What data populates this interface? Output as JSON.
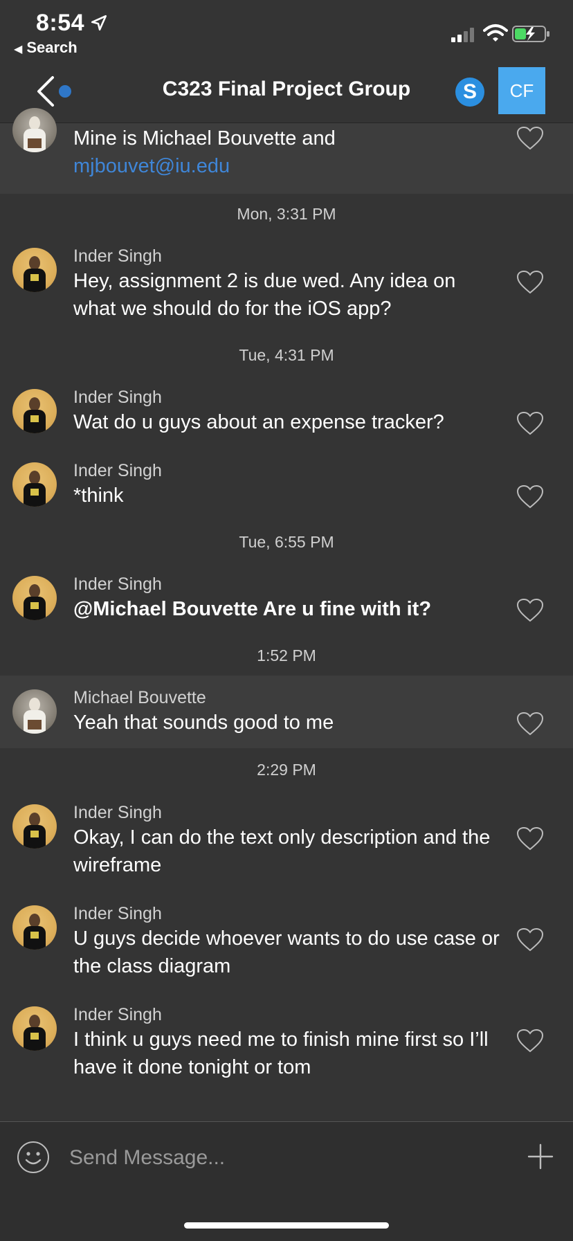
{
  "status_bar": {
    "time": "8:54",
    "back_app": "Search"
  },
  "header": {
    "title": "C323 Final Project Group",
    "skype_letter": "S",
    "user_initials": "CF"
  },
  "messages": [
    {
      "sender": "",
      "text": "Mine is Michael Bouvette and",
      "link": "mjbouvet@iu.edu"
    },
    {
      "timestamp": "Mon, 3:31 PM"
    },
    {
      "sender": "Inder Singh",
      "text": "Hey, assignment 2 is due wed. Any idea on what we should do for the iOS app?"
    },
    {
      "timestamp": "Tue, 4:31 PM"
    },
    {
      "sender": "Inder Singh",
      "text": "Wat do u guys about an expense tracker?"
    },
    {
      "sender": "Inder Singh",
      "text": "*think"
    },
    {
      "timestamp": "Tue, 6:55 PM"
    },
    {
      "sender": "Inder Singh",
      "text": "@Michael Bouvette Are u fine with it?"
    },
    {
      "timestamp": "1:52 PM"
    },
    {
      "sender": "Michael Bouvette",
      "text": "Yeah that sounds good to me"
    },
    {
      "timestamp": "2:29 PM"
    },
    {
      "sender": "Inder Singh",
      "text": "Okay, I can do the text only description and the wireframe"
    },
    {
      "sender": "Inder Singh",
      "text": "U guys decide whoever wants to do use case or the class diagram"
    },
    {
      "sender": "Inder Singh",
      "text": "I think u guys need me to finish mine first so I’ll have it done tonight or tom"
    }
  ],
  "composer": {
    "placeholder": "Send Message..."
  },
  "colors": {
    "background": "#343434",
    "highlight_row": "#3d3d3d",
    "link": "#3f86d8",
    "skype": "#2b8fe0",
    "avatar_tile": "#4aa9ee"
  }
}
